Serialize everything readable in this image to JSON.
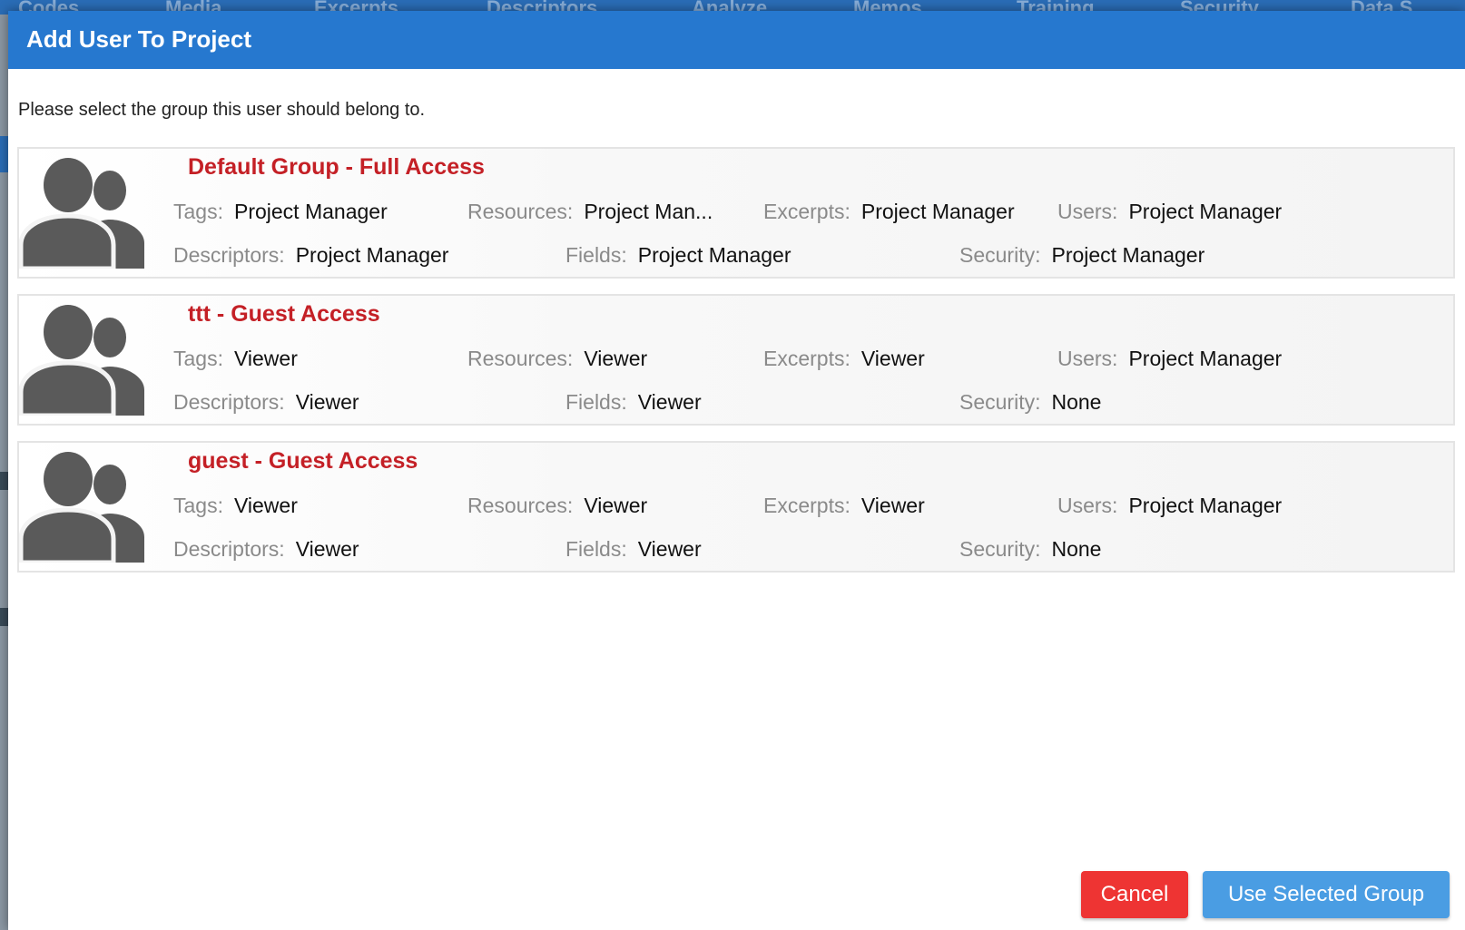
{
  "background": {
    "nav_items": [
      "Codes",
      "Media",
      "Excerpts",
      "Descriptors",
      "Analyze",
      "Memos",
      "Training",
      "Security",
      "Data S"
    ]
  },
  "dialog": {
    "title": "Add User To Project",
    "instruction": "Please select the group this user should belong to.",
    "labels": {
      "tags": "Tags:",
      "resources": "Resources:",
      "excerpts": "Excerpts:",
      "users": "Users:",
      "descriptors": "Descriptors:",
      "fields": "Fields:",
      "security": "Security:"
    },
    "groups": [
      {
        "name": "Default Group - Full Access",
        "tags": "Project Manager",
        "resources": "Project Man...",
        "excerpts": "Project Manager",
        "users": "Project Manager",
        "descriptors": "Project Manager",
        "fields": "Project Manager",
        "security": "Project Manager"
      },
      {
        "name": "ttt - Guest Access",
        "tags": "Viewer",
        "resources": "Viewer",
        "excerpts": "Viewer",
        "users": "Project Manager",
        "descriptors": "Viewer",
        "fields": "Viewer",
        "security": "None"
      },
      {
        "name": "guest - Guest Access",
        "tags": "Viewer",
        "resources": "Viewer",
        "excerpts": "Viewer",
        "users": "Project Manager",
        "descriptors": "Viewer",
        "fields": "Viewer",
        "security": "None"
      }
    ],
    "buttons": {
      "cancel": "Cancel",
      "use_selected": "Use Selected Group"
    }
  },
  "colors": {
    "header": "#2678cf",
    "group_name": "#c42026",
    "cancel": "#ee3433",
    "primary": "#4a9de3",
    "icon": "#5a5a5a"
  },
  "icons": {
    "group": "users-group-icon"
  }
}
